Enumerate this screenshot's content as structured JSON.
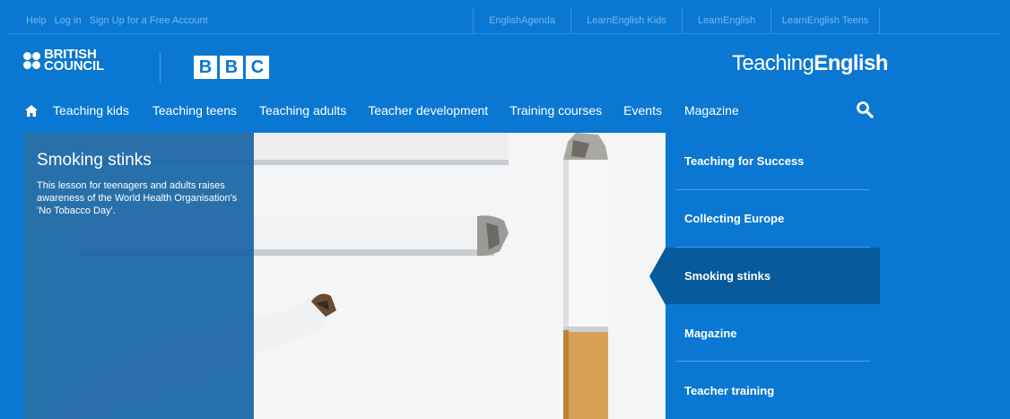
{
  "topbar": {
    "left_links": [
      "Help",
      "Log in",
      "Sign Up for a Free Account"
    ],
    "right_links": [
      "EnglishAgenda",
      "LearnEnglish Kids",
      "LearnEnglish",
      "LearnEnglish Teens"
    ]
  },
  "logos": {
    "british_council": [
      "BRITISH",
      "COUNCIL"
    ],
    "bbc": [
      "B",
      "B",
      "C"
    ],
    "teaching_english_light": "Teaching",
    "teaching_english_bold": "English"
  },
  "nav": {
    "items": [
      "Teaching kids",
      "Teaching teens",
      "Teaching adults",
      "Teacher development",
      "Training courses",
      "Events",
      "Magazine"
    ],
    "home_icon": "home-icon",
    "search_icon": "search-icon"
  },
  "hero": {
    "title": "Smoking stinks",
    "description": "This lesson for teenagers and adults raises awareness of the World Health Organisation's 'No Tobacco Day'."
  },
  "side_list": {
    "items": [
      "Teaching for Success",
      "Collecting Europe",
      "Smoking stinks",
      "Magazine",
      "Teacher training"
    ],
    "active": "Smoking stinks"
  },
  "colors": {
    "brand_blue": "#0a78d2",
    "active_blue": "#075a9b",
    "overlay_blue": "#0e5fa0"
  }
}
